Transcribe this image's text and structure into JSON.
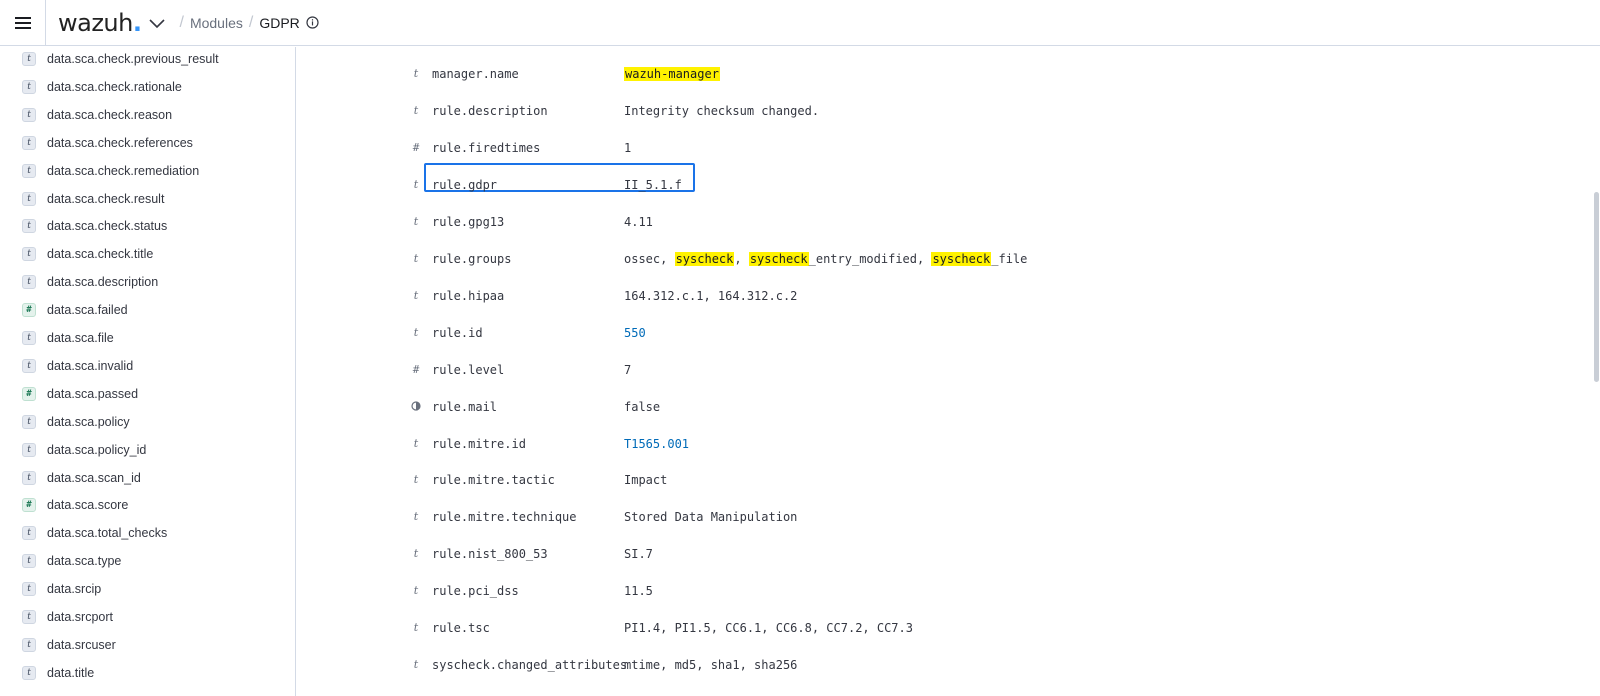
{
  "header": {
    "logo_text": "wazuh",
    "logo_dot": ".",
    "breadcrumbs": [
      "Modules",
      "GDPR"
    ],
    "icons": [
      "menu-icon",
      "chevron-down-icon",
      "info-icon"
    ],
    "accent_color": "#3595f9"
  },
  "sidebar": {
    "items": [
      {
        "type": "t",
        "label": "data.sca.check.previous_result"
      },
      {
        "type": "t",
        "label": "data.sca.check.rationale"
      },
      {
        "type": "t",
        "label": "data.sca.check.reason"
      },
      {
        "type": "t",
        "label": "data.sca.check.references"
      },
      {
        "type": "t",
        "label": "data.sca.check.remediation"
      },
      {
        "type": "t",
        "label": "data.sca.check.result"
      },
      {
        "type": "t",
        "label": "data.sca.check.status"
      },
      {
        "type": "t",
        "label": "data.sca.check.title"
      },
      {
        "type": "t",
        "label": "data.sca.description"
      },
      {
        "type": "#",
        "label": "data.sca.failed"
      },
      {
        "type": "t",
        "label": "data.sca.file"
      },
      {
        "type": "t",
        "label": "data.sca.invalid"
      },
      {
        "type": "#",
        "label": "data.sca.passed"
      },
      {
        "type": "t",
        "label": "data.sca.policy"
      },
      {
        "type": "t",
        "label": "data.sca.policy_id"
      },
      {
        "type": "t",
        "label": "data.sca.scan_id"
      },
      {
        "type": "#",
        "label": "data.sca.score"
      },
      {
        "type": "t",
        "label": "data.sca.total_checks"
      },
      {
        "type": "t",
        "label": "data.sca.type"
      },
      {
        "type": "t",
        "label": "data.srcip"
      },
      {
        "type": "t",
        "label": "data.srcport"
      },
      {
        "type": "t",
        "label": "data.srcuser"
      },
      {
        "type": "t",
        "label": "data.title"
      }
    ]
  },
  "document": {
    "highlight_color": "#fff200",
    "selected_row": "rule.gdpr",
    "rows": [
      {
        "type": "t",
        "key": "manager.name",
        "segments": [
          {
            "text": "wazuh-manager",
            "hl": true
          }
        ]
      },
      {
        "type": "t",
        "key": "rule.description",
        "segments": [
          {
            "text": "Integrity checksum changed."
          }
        ]
      },
      {
        "type": "#",
        "key": "rule.firedtimes",
        "segments": [
          {
            "text": "1"
          }
        ]
      },
      {
        "type": "t",
        "key": "rule.gdpr",
        "segments": [
          {
            "text": "II_5.1.f"
          }
        ]
      },
      {
        "type": "t",
        "key": "rule.gpg13",
        "segments": [
          {
            "text": "4.11"
          }
        ]
      },
      {
        "type": "t",
        "key": "rule.groups",
        "segments": [
          {
            "text": "ossec, "
          },
          {
            "text": "syscheck",
            "hl": true
          },
          {
            "text": ", "
          },
          {
            "text": "syscheck",
            "hl": true
          },
          {
            "text": "_entry_modified, "
          },
          {
            "text": "syscheck",
            "hl": true
          },
          {
            "text": "_file"
          }
        ]
      },
      {
        "type": "t",
        "key": "rule.hipaa",
        "segments": [
          {
            "text": "164.312.c.1, 164.312.c.2"
          }
        ]
      },
      {
        "type": "t",
        "key": "rule.id",
        "link": true,
        "segments": [
          {
            "text": "550"
          }
        ]
      },
      {
        "type": "#",
        "key": "rule.level",
        "segments": [
          {
            "text": "7"
          }
        ]
      },
      {
        "type": "bool",
        "key": "rule.mail",
        "segments": [
          {
            "text": "false"
          }
        ]
      },
      {
        "type": "t",
        "key": "rule.mitre.id",
        "link": true,
        "segments": [
          {
            "text": "T1565.001"
          }
        ]
      },
      {
        "type": "t",
        "key": "rule.mitre.tactic",
        "segments": [
          {
            "text": "Impact"
          }
        ]
      },
      {
        "type": "t",
        "key": "rule.mitre.technique",
        "segments": [
          {
            "text": "Stored Data Manipulation"
          }
        ]
      },
      {
        "type": "t",
        "key": "rule.nist_800_53",
        "segments": [
          {
            "text": "SI.7"
          }
        ]
      },
      {
        "type": "t",
        "key": "rule.pci_dss",
        "segments": [
          {
            "text": "11.5"
          }
        ]
      },
      {
        "type": "t",
        "key": "rule.tsc",
        "segments": [
          {
            "text": "PI1.4, PI1.5, CC6.1, CC6.8, CC7.2, CC7.3"
          }
        ]
      },
      {
        "type": "t",
        "key": "syscheck.changed_attributes",
        "segments": [
          {
            "text": "mtime, md5, sha1, sha256"
          }
        ]
      }
    ]
  }
}
